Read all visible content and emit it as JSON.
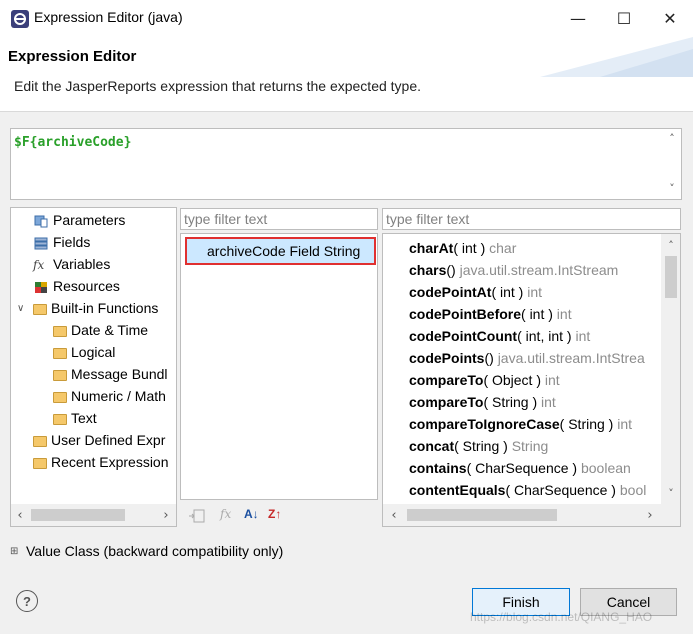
{
  "window": {
    "title": "Expression Editor (java)",
    "minimize": "—",
    "maximize": "☐",
    "close": "✕"
  },
  "header": {
    "title": "Expression Editor",
    "description": "Edit the JasperReports expression that returns the expected type."
  },
  "expression": {
    "text": "$F{archiveCode}"
  },
  "categories": {
    "items": [
      {
        "label": "Parameters",
        "icon": "parameters-icon"
      },
      {
        "label": "Fields",
        "icon": "fields-icon",
        "selected": true
      },
      {
        "label": "Variables",
        "icon": "variables-icon"
      },
      {
        "label": "Resources",
        "icon": "resources-icon"
      },
      {
        "label": "Built-in Functions",
        "icon": "folder-icon"
      },
      {
        "label": "Date & Time",
        "icon": "folder-icon"
      },
      {
        "label": "Logical",
        "icon": "folder-icon"
      },
      {
        "label": "Message Bundl",
        "icon": "folder-icon"
      },
      {
        "label": "Numeric / Math",
        "icon": "folder-icon"
      },
      {
        "label": "Text",
        "icon": "folder-icon"
      },
      {
        "label": "User Defined Expr",
        "icon": "folder-icon"
      },
      {
        "label": "Recent Expression",
        "icon": "folder-icon"
      }
    ],
    "fx_glyph": "fx"
  },
  "fields_panel": {
    "filter_placeholder": "type filter text",
    "items": [
      {
        "label": "archiveCode Field String"
      }
    ]
  },
  "methods_panel": {
    "filter_placeholder": "type filter text",
    "items": [
      {
        "name": "charAt",
        "args": "( int )",
        "ret": "char"
      },
      {
        "name": "chars",
        "args": "()",
        "ret": "java.util.stream.IntStream"
      },
      {
        "name": "codePointAt",
        "args": "( int )",
        "ret": "int"
      },
      {
        "name": "codePointBefore",
        "args": "( int )",
        "ret": "int"
      },
      {
        "name": "codePointCount",
        "args": "( int, int )",
        "ret": "int"
      },
      {
        "name": "codePoints",
        "args": "()",
        "ret": "java.util.stream.IntStrea"
      },
      {
        "name": "compareTo",
        "args": "( Object )",
        "ret": "int"
      },
      {
        "name": "compareTo",
        "args": "( String )",
        "ret": "int"
      },
      {
        "name": "compareToIgnoreCase",
        "args": "( String )",
        "ret": "int"
      },
      {
        "name": "concat",
        "args": "( String )",
        "ret": "String"
      },
      {
        "name": "contains",
        "args": "( CharSequence )",
        "ret": "boolean"
      },
      {
        "name": "contentEquals",
        "args": "( CharSequence )",
        "ret": "bool"
      }
    ]
  },
  "toolbar": {
    "sort_az": "A↓",
    "sort_za": "Z↑",
    "fx": "fx"
  },
  "value_class": {
    "label": "Value Class (backward compatibility only)",
    "toggle": "⊞"
  },
  "footer": {
    "help": "?",
    "finish": "Finish",
    "cancel": "Cancel",
    "watermark": "https://blog.csdn.net/QIANG_HAO"
  },
  "colors": {
    "expression": "#2aa02a",
    "selection": "#cce8ff",
    "highlight_border": "#e03030",
    "accent": "#0078d7"
  }
}
